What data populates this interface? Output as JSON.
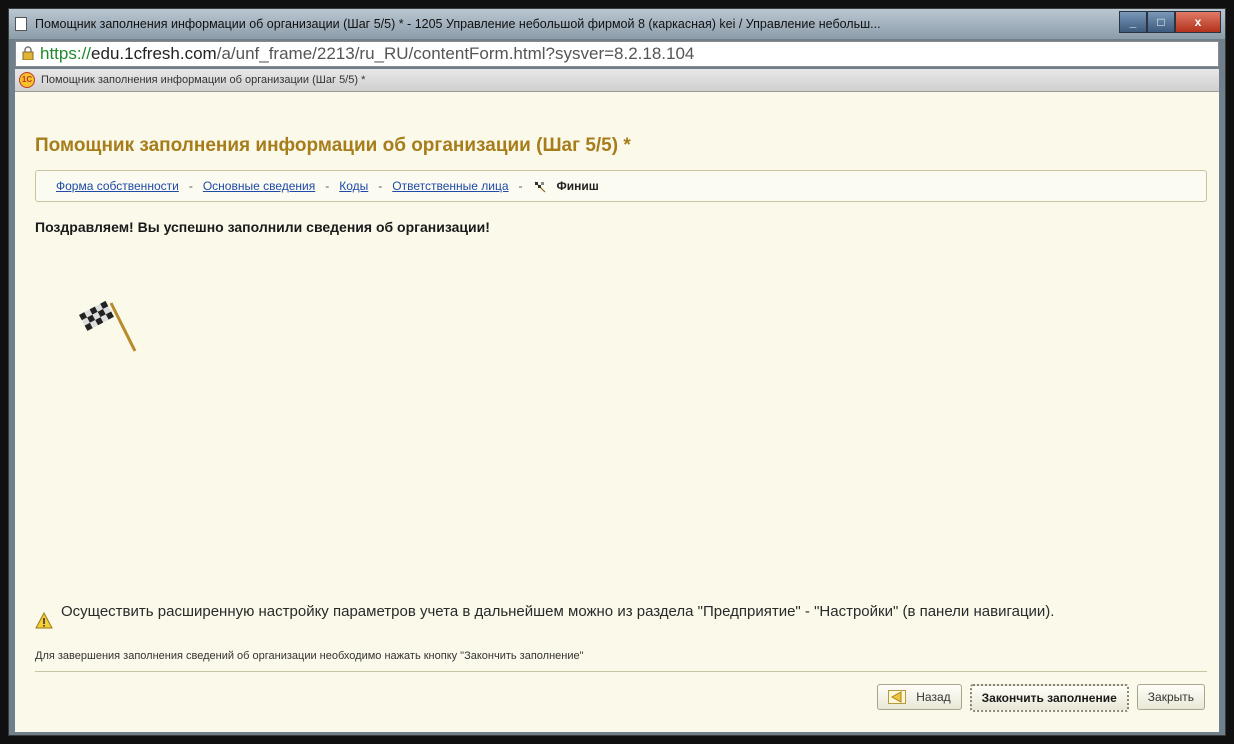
{
  "window": {
    "title": "Помощник заполнения информации об организации (Шаг 5/5) * - 1205 Управление небольшой фирмой 8 (каркасная) kei / Управление небольш...",
    "buttons": {
      "minimize": "_",
      "maximize": "□",
      "close": "x"
    }
  },
  "address_bar": {
    "scheme": "https://",
    "host": "edu.1cfresh.com",
    "path": "/a/unf_frame/2213/ru_RU/contentForm.html?sysver=8.2.18.104"
  },
  "tab": {
    "logo": "1С",
    "label": "Помощник заполнения информации об организации (Шаг 5/5) *"
  },
  "form": {
    "heading": "Помощник заполнения информации об организации (Шаг 5/5) *",
    "steps": [
      {
        "label": "Форма собственности"
      },
      {
        "label": "Основные сведения"
      },
      {
        "label": "Коды"
      },
      {
        "label": "Ответственные лица"
      },
      {
        "label": "Финиш"
      }
    ],
    "step_separator": "-",
    "congrats": "Поздравляем! Вы успешно заполнили сведения об организации!",
    "notice": "Осуществить расширенную настройку параметров учета в дальнейшем можно из раздела \"Предприятие\" - \"Настройки\" (в панели навигации).",
    "hint": "Для завершения заполнения сведений об организации необходимо нажать кнопку \"Закончить заполнение\"",
    "buttons": {
      "back": "Назад",
      "finish": "Закончить заполнение",
      "close": "Закрыть"
    }
  },
  "icons": {
    "finish_flag": "checkered-flag-icon",
    "warning": "warning-icon",
    "back": "back-arrow-icon"
  },
  "colors": {
    "heading": "#a77d1b",
    "link": "#1f4aa8",
    "background": "#fbf9ea"
  }
}
